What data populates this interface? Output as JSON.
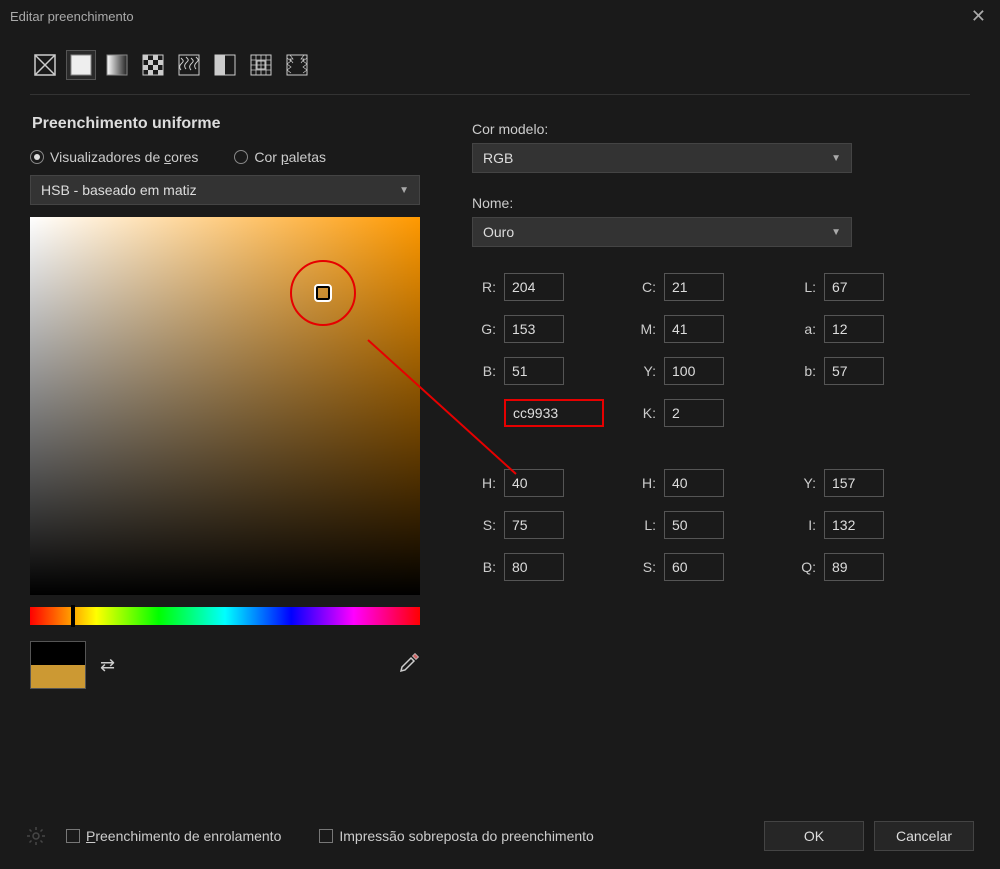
{
  "title": "Editar preenchimento",
  "section_title": "Preenchimento uniforme",
  "radios": {
    "viewers": "Visualizadores de ",
    "viewers_ul": "c",
    "viewers_rest": "ores",
    "palettes": "Cor ",
    "palettes_ul": "p",
    "palettes_rest": "aletas"
  },
  "viewer_dropdown": "HSB - baseado em matiz",
  "model_label": "Cor modelo:",
  "model_value": "RGB",
  "name_label": "Nome:",
  "name_value": "Ouro",
  "hex": "cc9933",
  "vals": {
    "R": "204",
    "G": "153",
    "B": "51",
    "C": "21",
    "M": "41",
    "Y": "100",
    "K": "2",
    "L": "67",
    "a": "12",
    "b2": "57",
    "H": "40",
    "S": "75",
    "Bv": "80",
    "H2": "40",
    "L2": "50",
    "S2": "60",
    "Y2": "157",
    "I": "132",
    "Q": "89"
  },
  "swatch_old": "#000000",
  "swatch_new": "#cc9933",
  "footer": {
    "wind_pre": "P",
    "wind": "reenchimento de enrolamento",
    "over": "Impressão sobreposta do preenchimento",
    "ok": "OK",
    "cancel": "Cancelar"
  },
  "fill_tools": [
    "none",
    "uniform",
    "gradient",
    "pattern",
    "texture",
    "two-color",
    "postscript",
    "bitmap"
  ]
}
